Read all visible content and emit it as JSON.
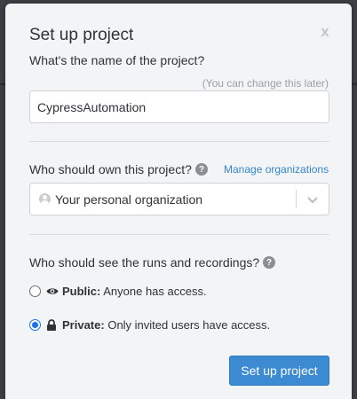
{
  "modal": {
    "title": "Set up project",
    "close_label": "x"
  },
  "name_section": {
    "label": "What's the name of the project?",
    "hint": "(You can change this later)",
    "value": "CypressAutomation"
  },
  "owner_section": {
    "label": "Who should own this project?",
    "help_icon": "question-circle-icon",
    "help_glyph": "?",
    "manage_link": "Manage organizations",
    "selected_org": "Your personal organization",
    "select_icon": "chevron-down-icon"
  },
  "visibility_section": {
    "label": "Who should see the runs and recordings?",
    "help_glyph": "?",
    "options": [
      {
        "icon": "eye-icon",
        "title": "Public:",
        "description": "Anyone has access.",
        "checked": false
      },
      {
        "icon": "lock-icon",
        "title": "Private:",
        "description": "Only invited users have access.",
        "checked": true
      }
    ]
  },
  "actions": {
    "submit_label": "Set up project"
  },
  "colors": {
    "primary": "#3c8ad1",
    "link": "#3486cc",
    "radio_checked": "#1a73e8",
    "modal_bg": "#f3f4f5",
    "backdrop": "#3c3f44"
  }
}
